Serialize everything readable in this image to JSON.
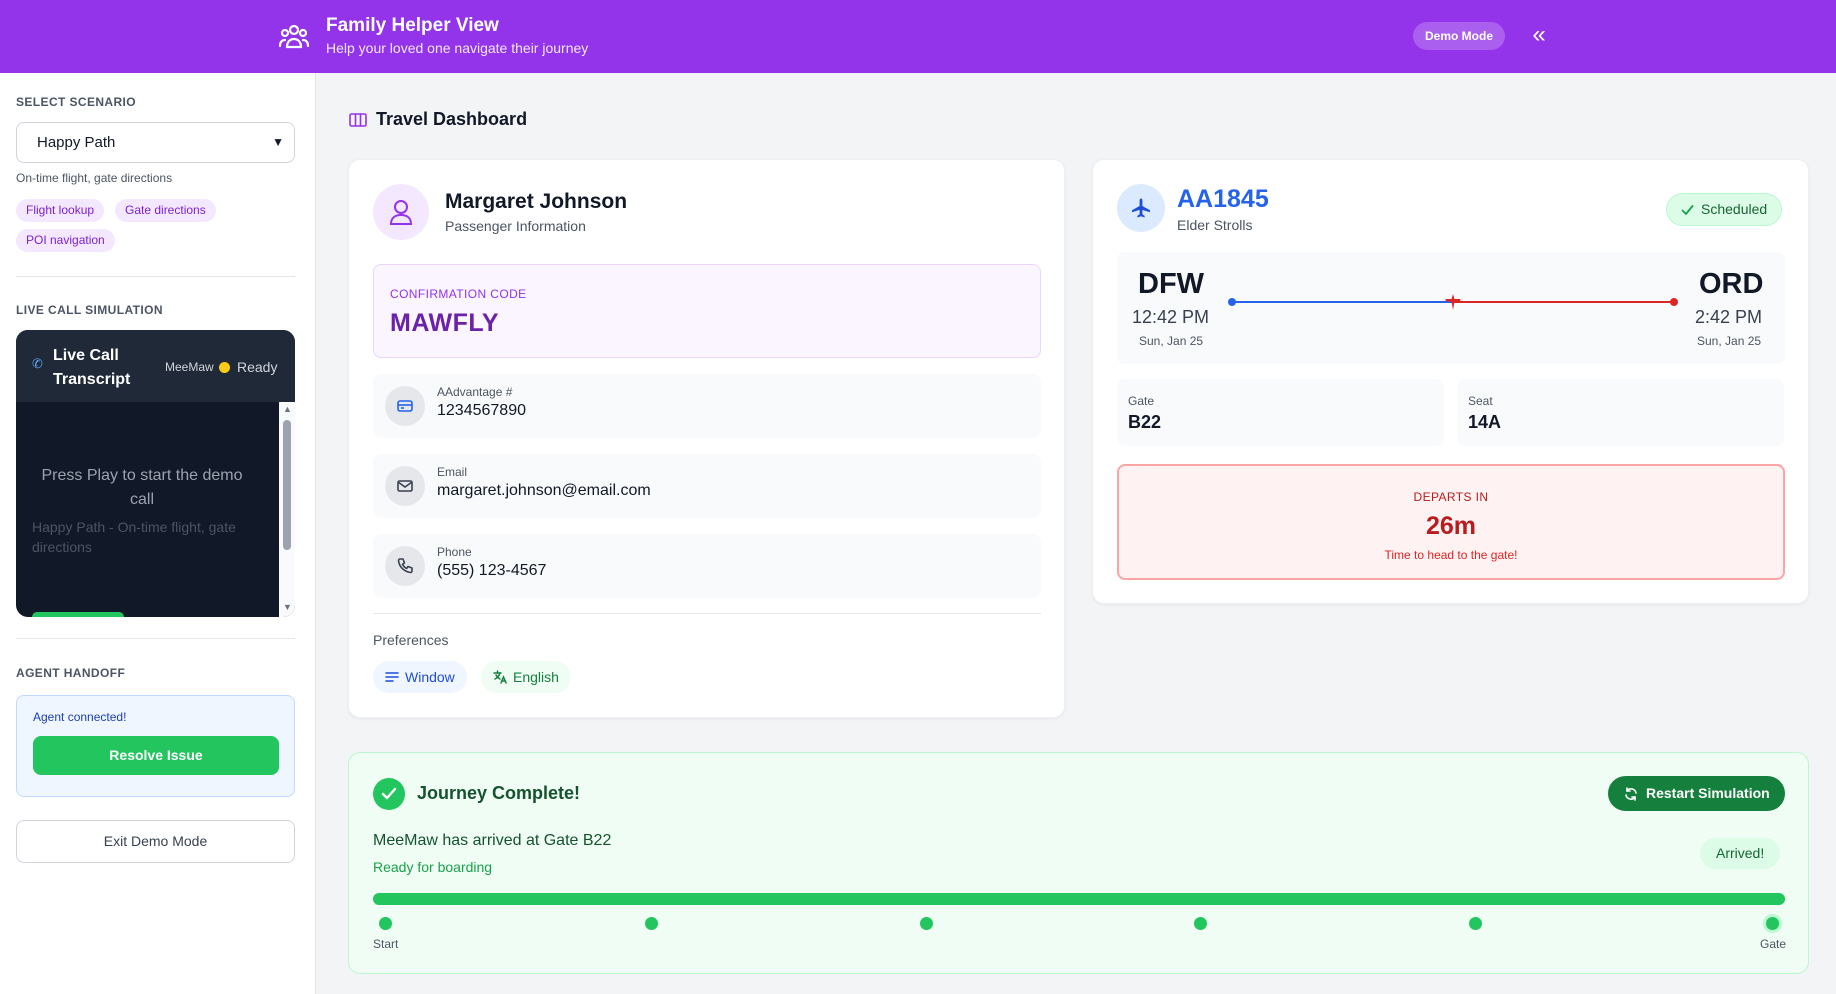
{
  "header": {
    "title": "Family Helper View",
    "subtitle": "Help your loved one navigate their journey",
    "demo_badge": "Demo Mode",
    "collapse_icon": "chevrons-left-icon"
  },
  "sidebar": {
    "scenario": {
      "heading": "SELECT SCENARIO",
      "selected": "Happy Path",
      "description": "On-time flight, gate directions",
      "tags": [
        "Flight lookup",
        "Gate directions",
        "POI navigation"
      ]
    },
    "call": {
      "heading": "LIVE CALL SIMULATION",
      "title": "Live Call Transcript",
      "caller": "MeeMaw",
      "status": "Ready",
      "status_color": "#facc15",
      "prompt": "Press Play to start the demo call",
      "subtext": "Happy Path - On-time flight, gate directions"
    },
    "handoff": {
      "heading": "AGENT HANDOFF",
      "status": "Agent connected!",
      "resolve_label": "Resolve Issue"
    },
    "exit_label": "Exit Demo Mode"
  },
  "main": {
    "title": "Travel Dashboard",
    "passenger": {
      "name": "Margaret Johnson",
      "subtitle": "Passenger Information",
      "confirmation_label": "CONFIRMATION CODE",
      "confirmation_code": "MAWFLY",
      "fields": [
        {
          "label": "AAdvantage #",
          "value": "1234567890",
          "icon": "credit-card-icon"
        },
        {
          "label": "Email",
          "value": "margaret.johnson@email.com",
          "icon": "mail-icon"
        },
        {
          "label": "Phone",
          "value": "(555) 123-4567",
          "icon": "phone-icon"
        }
      ],
      "preferences_label": "Preferences",
      "preferences": [
        {
          "label": "Window",
          "icon": "seat-icon",
          "color": "#1d4ed8"
        },
        {
          "label": "English",
          "icon": "language-icon",
          "color": "#15803d"
        }
      ]
    },
    "flight": {
      "number": "AA1845",
      "subtitle": "Elder Strolls",
      "status": "Scheduled",
      "origin": {
        "code": "DFW",
        "time": "12:42 PM",
        "date": "Sun, Jan 25"
      },
      "destination": {
        "code": "ORD",
        "time": "2:42 PM",
        "date": "Sun, Jan 25"
      },
      "gate_label": "Gate",
      "gate": "B22",
      "seat_label": "Seat",
      "seat": "14A",
      "departs_label": "DEPARTS IN",
      "departs_value": "26m",
      "departs_note": "Time to head to the gate!"
    },
    "journey": {
      "title": "Journey Complete!",
      "restart_label": "Restart Simulation",
      "message": "MeeMaw has arrived at Gate B22",
      "submessage": "Ready for boarding",
      "badge": "Arrived!",
      "progress": 1.0,
      "start_label": "Start",
      "end_label": "Gate"
    }
  },
  "colors": {
    "brand": "#9333ea",
    "success": "#22c55e",
    "danger": "#b91c1c",
    "flight_blue": "#2563eb"
  }
}
